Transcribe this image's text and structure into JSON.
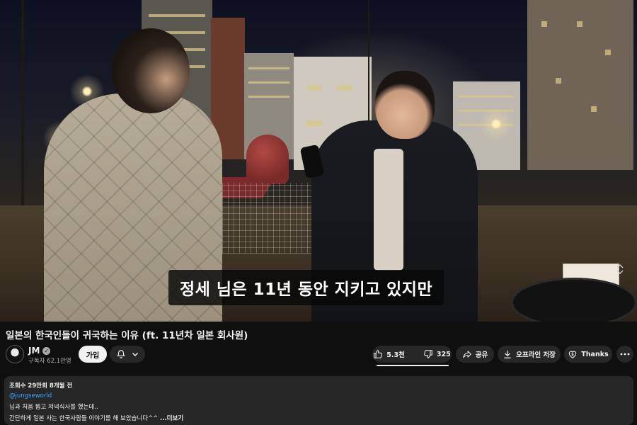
{
  "video": {
    "subtitle": "정세 님은 11년 동안 지키고 있지만"
  },
  "title": "일본의 한국인들이 귀국하는 이유 (ft. 11년차 일본 회사원)",
  "channel": {
    "name": "JM",
    "subscribers": "구독자 62.1만명",
    "verified": true
  },
  "actions": {
    "join_label": "가입",
    "like_count": "5.3천",
    "dislike_count": "325",
    "share_label": "공유",
    "offline_label": "오프라인 저장",
    "thanks_label": "Thanks"
  },
  "description": {
    "meta": "조회수 29만회  8개월 전",
    "tag": "@jungseworld",
    "line1": "님과 처음 뵙고 저녁식사를 했는데..",
    "line2": "간단하게 일본 사는 한국사람들 이야기를 해 보았습니다^^",
    "more_label": "...더보기"
  },
  "icons": {
    "verified": "check-circle-icon",
    "bell": "bell-icon",
    "chevron": "chevron-down-icon",
    "like": "thumbs-up-icon",
    "dislike": "thumbs-down-icon",
    "share": "share-arrow-icon",
    "download": "download-icon",
    "thanks": "dollar-heart-icon",
    "more": "more-horizontal-icon"
  },
  "colors": {
    "background": "#0f0f0f",
    "pill": "#272727",
    "link": "#3ea6ff",
    "text": "#f1f1f1",
    "secondary_text": "#aaaaaa"
  }
}
